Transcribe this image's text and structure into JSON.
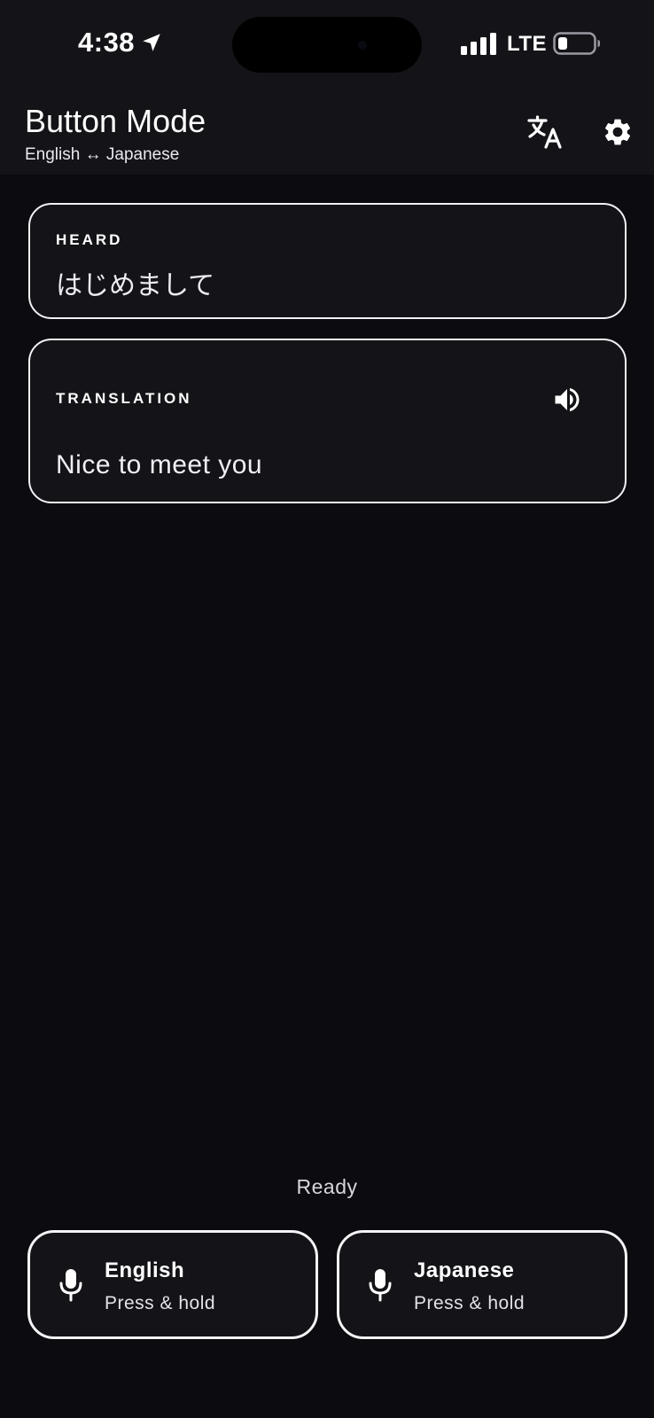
{
  "status_bar": {
    "time": "4:38",
    "carrier": "LTE"
  },
  "header": {
    "title": "Button Mode",
    "subtitle": "English ↔ Japanese",
    "translate_icon": "translate-icon",
    "settings_icon": "gear-icon"
  },
  "heard": {
    "label": "HEARD",
    "text": "はじめまして"
  },
  "translation": {
    "label": "TRANSLATION",
    "text": "Nice to meet you",
    "speak_icon": "speaker-icon"
  },
  "status": "Ready",
  "buttons": [
    {
      "language": "English",
      "hint": "Press & hold",
      "icon": "microphone-icon"
    },
    {
      "language": "Japanese",
      "hint": "Press & hold",
      "icon": "microphone-icon"
    }
  ],
  "colors": {
    "background": "#0c0c10",
    "surface": "#141418",
    "border": "#f2f2f5",
    "text": "#ffffff"
  }
}
